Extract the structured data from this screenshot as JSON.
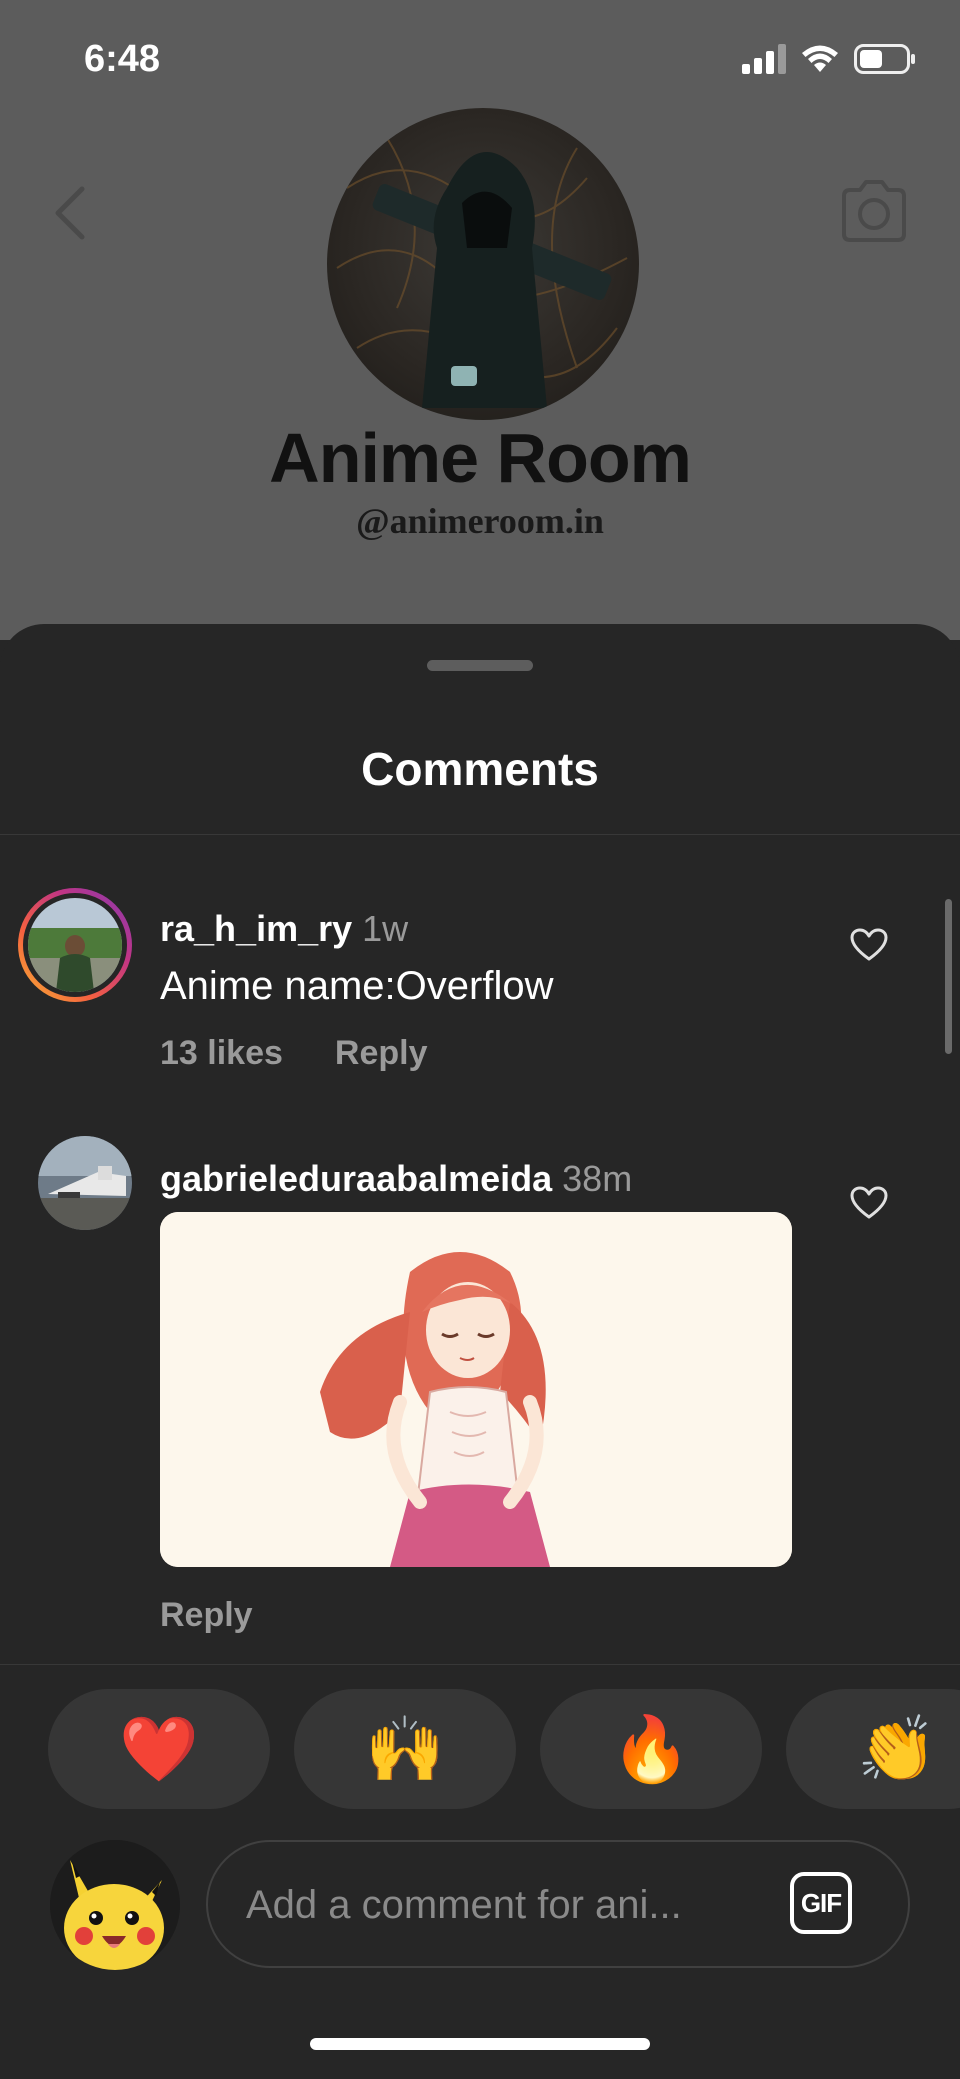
{
  "status_bar": {
    "time": "6:48",
    "icons": [
      "signal-icon",
      "wifi-icon",
      "battery-icon"
    ]
  },
  "profile": {
    "name": "Anime Room",
    "handle": "@animeroom.in",
    "nav_icons": [
      "back-chevron-icon",
      "camera-icon"
    ]
  },
  "sheet": {
    "title": "Comments"
  },
  "comments": [
    {
      "username": "ra_h_im_ry",
      "time": "1w",
      "text": "Anime name:Overflow",
      "likes": "13 likes",
      "reply": "Reply",
      "has_story_ring": true
    },
    {
      "username": "gabrieleduraabalmeida",
      "time": "38m",
      "media": "gif",
      "reply": "Reply",
      "has_story_ring": false
    }
  ],
  "reactions": [
    "❤️",
    "🙌",
    "🔥",
    "👏"
  ],
  "composer": {
    "placeholder": "Add a comment for ani...",
    "gif_label": "GIF"
  },
  "colors": {
    "background": "#262626",
    "secondary_text": "#9a9a9a",
    "story_ring_start": "#f7b733",
    "story_ring_end": "#c13584"
  }
}
